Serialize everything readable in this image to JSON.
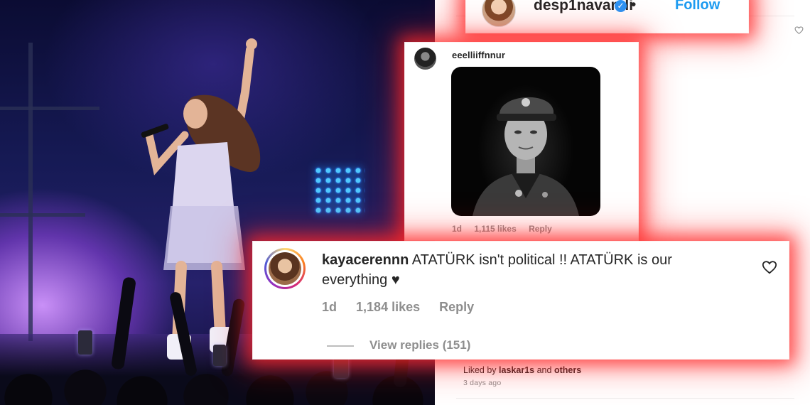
{
  "post_header": {
    "username": "desp1navandi",
    "separator": "•",
    "follow_label": "Follow"
  },
  "comment_image": {
    "username": "eeelliiffnnur",
    "time": "1d",
    "likes": "1,115 likes",
    "reply_label": "Reply"
  },
  "comment_main": {
    "username": "kayacerennn",
    "text": "ATATÜRK isn't political !! ATATÜRK is our everything",
    "emoji": "♥",
    "time": "1d",
    "likes": "1,184 likes",
    "reply_label": "Reply",
    "view_replies": "View replies (151)"
  },
  "post_footer": {
    "liked_by_prefix": "Liked by",
    "liked_by_user": "laskar1s",
    "liked_by_suffix": "and",
    "liked_by_others": "others",
    "time_ago": "3 days ago"
  },
  "colors": {
    "glow": "#ff2828",
    "follow_blue": "#1d9bf0",
    "verified_blue": "#2b94f5",
    "muted": "#8e8e8e",
    "text": "#262626"
  },
  "icons": [
    "heart-outline-icon",
    "verified-badge-icon"
  ]
}
